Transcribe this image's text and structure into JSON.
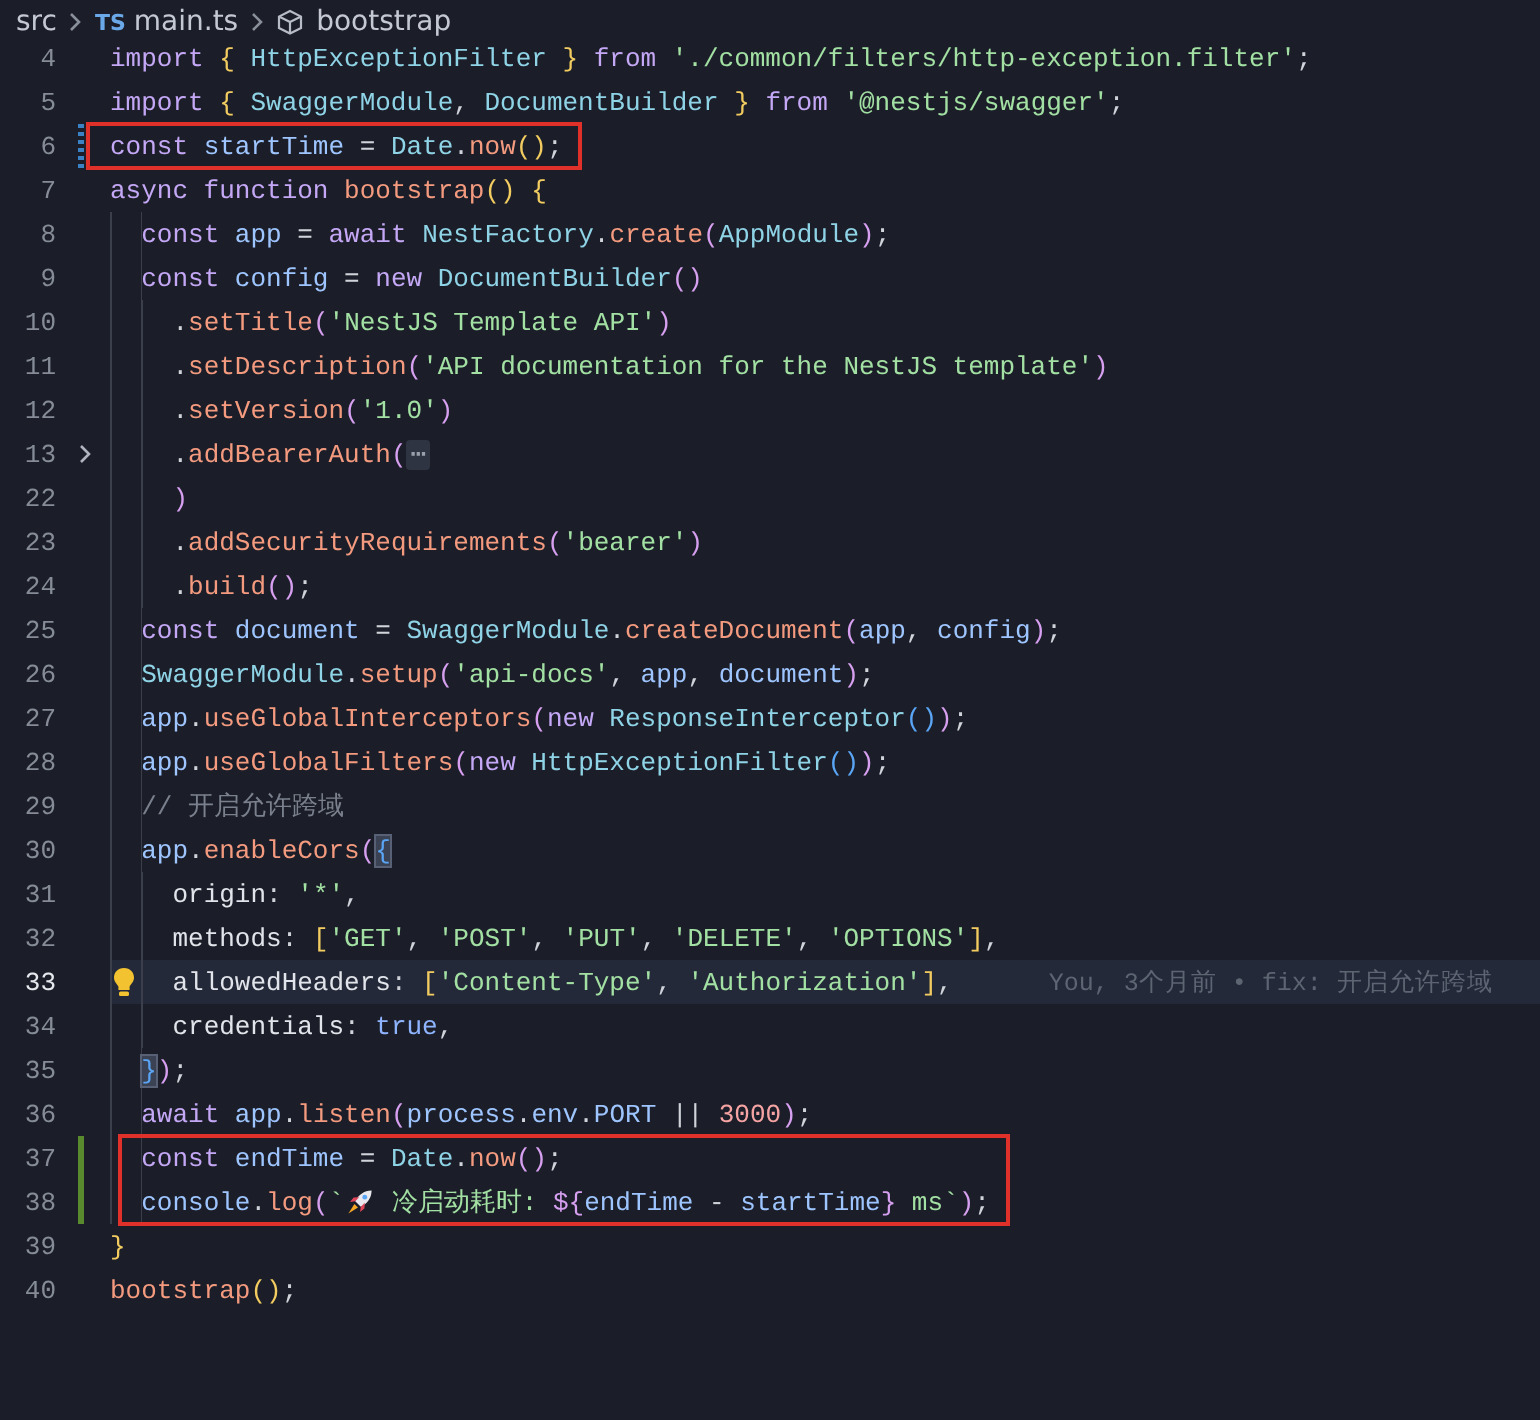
{
  "breadcrumb": {
    "folder": "src",
    "file_type": "TS",
    "file": "main.ts",
    "symbol": "bootstrap"
  },
  "lines": [
    {
      "n": "4",
      "modified": false,
      "added": false,
      "current": false,
      "folded": false,
      "boxed": false,
      "lightbulb": false,
      "tokens": [
        {
          "text": "import ",
          "kind": "keyword"
        },
        {
          "text": "{",
          "kind": "bracket1"
        },
        {
          "text": " HttpExceptionFilter ",
          "kind": "class"
        },
        {
          "text": "}",
          "kind": "bracket1"
        },
        {
          "text": " from ",
          "kind": "keyword"
        },
        {
          "text": "'./common/filters/http-exception.filter'",
          "kind": "string"
        },
        {
          "text": ";",
          "kind": "punctuation"
        }
      ]
    },
    {
      "n": "5",
      "modified": false,
      "added": false,
      "current": false,
      "folded": false,
      "boxed": false,
      "lightbulb": false,
      "tokens": [
        {
          "text": "import ",
          "kind": "keyword"
        },
        {
          "text": "{",
          "kind": "bracket1"
        },
        {
          "text": " SwaggerModule",
          "kind": "class"
        },
        {
          "text": ", ",
          "kind": "punctuation"
        },
        {
          "text": "DocumentBuilder ",
          "kind": "class"
        },
        {
          "text": "}",
          "kind": "bracket1"
        },
        {
          "text": " from ",
          "kind": "keyword"
        },
        {
          "text": "'@nestjs/swagger'",
          "kind": "string"
        },
        {
          "text": ";",
          "kind": "punctuation"
        }
      ]
    },
    {
      "n": "6",
      "modified": true,
      "added": false,
      "current": false,
      "folded": false,
      "boxed": true,
      "lightbulb": false,
      "tokens": [
        {
          "text": "const",
          "kind": "keyword"
        },
        {
          "text": " startTime",
          "kind": "variable"
        },
        {
          "text": " = ",
          "kind": "punctuation"
        },
        {
          "text": "Date",
          "kind": "class"
        },
        {
          "text": ".",
          "kind": "punctuation"
        },
        {
          "text": "now",
          "kind": "function"
        },
        {
          "text": "()",
          "kind": "bracket1"
        },
        {
          "text": ";",
          "kind": "punctuation"
        }
      ]
    },
    {
      "n": "7",
      "modified": false,
      "added": false,
      "current": false,
      "folded": false,
      "boxed": false,
      "lightbulb": false,
      "tokens": [
        {
          "text": "async function",
          "kind": "keyword"
        },
        {
          "text": " bootstrap",
          "kind": "function"
        },
        {
          "text": "() {",
          "kind": "bracket1"
        }
      ]
    },
    {
      "n": "8",
      "modified": false,
      "added": false,
      "current": false,
      "folded": false,
      "boxed": false,
      "lightbulb": false,
      "tokens": [
        {
          "text": "  const",
          "kind": "keyword"
        },
        {
          "text": " app",
          "kind": "variable"
        },
        {
          "text": " = ",
          "kind": "punctuation"
        },
        {
          "text": "await",
          "kind": "keyword"
        },
        {
          "text": " NestFactory",
          "kind": "class"
        },
        {
          "text": ".",
          "kind": "punctuation"
        },
        {
          "text": "create",
          "kind": "function"
        },
        {
          "text": "(",
          "kind": "bracket2"
        },
        {
          "text": "AppModule",
          "kind": "class"
        },
        {
          "text": ")",
          "kind": "bracket2"
        },
        {
          "text": ";",
          "kind": "punctuation"
        }
      ]
    },
    {
      "n": "9",
      "modified": false,
      "added": false,
      "current": false,
      "folded": false,
      "boxed": false,
      "lightbulb": false,
      "tokens": [
        {
          "text": "  const",
          "kind": "keyword"
        },
        {
          "text": " config",
          "kind": "variable"
        },
        {
          "text": " = ",
          "kind": "punctuation"
        },
        {
          "text": "new",
          "kind": "keyword"
        },
        {
          "text": " DocumentBuilder",
          "kind": "class"
        },
        {
          "text": "()",
          "kind": "bracket2"
        }
      ]
    },
    {
      "n": "10",
      "modified": false,
      "added": false,
      "current": false,
      "folded": false,
      "boxed": false,
      "lightbulb": false,
      "tokens": [
        {
          "text": "    .",
          "kind": "punctuation"
        },
        {
          "text": "setTitle",
          "kind": "function"
        },
        {
          "text": "(",
          "kind": "bracket2"
        },
        {
          "text": "'NestJS Template API'",
          "kind": "string"
        },
        {
          "text": ")",
          "kind": "bracket2"
        }
      ]
    },
    {
      "n": "11",
      "modified": false,
      "added": false,
      "current": false,
      "folded": false,
      "boxed": false,
      "lightbulb": false,
      "tokens": [
        {
          "text": "    .",
          "kind": "punctuation"
        },
        {
          "text": "setDescription",
          "kind": "function"
        },
        {
          "text": "(",
          "kind": "bracket2"
        },
        {
          "text": "'API documentation for the NestJS template'",
          "kind": "string"
        },
        {
          "text": ")",
          "kind": "bracket2"
        }
      ]
    },
    {
      "n": "12",
      "modified": false,
      "added": false,
      "current": false,
      "folded": false,
      "boxed": false,
      "lightbulb": false,
      "tokens": [
        {
          "text": "    .",
          "kind": "punctuation"
        },
        {
          "text": "setVersion",
          "kind": "function"
        },
        {
          "text": "(",
          "kind": "bracket2"
        },
        {
          "text": "'1.0'",
          "kind": "string"
        },
        {
          "text": ")",
          "kind": "bracket2"
        }
      ]
    },
    {
      "n": "13",
      "modified": false,
      "added": false,
      "current": false,
      "folded": true,
      "boxed": false,
      "lightbulb": false,
      "tokens": [
        {
          "text": "    .",
          "kind": "punctuation"
        },
        {
          "text": "addBearerAuth",
          "kind": "function"
        },
        {
          "text": "(",
          "kind": "bracket2"
        },
        {
          "text": "⋯",
          "kind": "fold"
        }
      ]
    },
    {
      "n": "22",
      "modified": false,
      "added": false,
      "current": false,
      "folded": false,
      "boxed": false,
      "lightbulb": false,
      "tokens": [
        {
          "text": "    )",
          "kind": "bracket2"
        }
      ]
    },
    {
      "n": "23",
      "modified": false,
      "added": false,
      "current": false,
      "folded": false,
      "boxed": false,
      "lightbulb": false,
      "tokens": [
        {
          "text": "    .",
          "kind": "punctuation"
        },
        {
          "text": "addSecurityRequirements",
          "kind": "function"
        },
        {
          "text": "(",
          "kind": "bracket2"
        },
        {
          "text": "'bearer'",
          "kind": "string"
        },
        {
          "text": ")",
          "kind": "bracket2"
        }
      ]
    },
    {
      "n": "24",
      "modified": false,
      "added": false,
      "current": false,
      "folded": false,
      "boxed": false,
      "lightbulb": false,
      "tokens": [
        {
          "text": "    .",
          "kind": "punctuation"
        },
        {
          "text": "build",
          "kind": "function"
        },
        {
          "text": "()",
          "kind": "bracket2"
        },
        {
          "text": ";",
          "kind": "punctuation"
        }
      ]
    },
    {
      "n": "25",
      "modified": false,
      "added": false,
      "current": false,
      "folded": false,
      "boxed": false,
      "lightbulb": false,
      "tokens": [
        {
          "text": "  const",
          "kind": "keyword"
        },
        {
          "text": " document",
          "kind": "variable"
        },
        {
          "text": " = ",
          "kind": "punctuation"
        },
        {
          "text": "SwaggerModule",
          "kind": "class"
        },
        {
          "text": ".",
          "kind": "punctuation"
        },
        {
          "text": "createDocument",
          "kind": "function"
        },
        {
          "text": "(",
          "kind": "bracket2"
        },
        {
          "text": "app",
          "kind": "variable"
        },
        {
          "text": ", ",
          "kind": "punctuation"
        },
        {
          "text": "config",
          "kind": "variable"
        },
        {
          "text": ")",
          "kind": "bracket2"
        },
        {
          "text": ";",
          "kind": "punctuation"
        }
      ]
    },
    {
      "n": "26",
      "modified": false,
      "added": false,
      "current": false,
      "folded": false,
      "boxed": false,
      "lightbulb": false,
      "tokens": [
        {
          "text": "  SwaggerModule",
          "kind": "class"
        },
        {
          "text": ".",
          "kind": "punctuation"
        },
        {
          "text": "setup",
          "kind": "function"
        },
        {
          "text": "(",
          "kind": "bracket2"
        },
        {
          "text": "'api-docs'",
          "kind": "string"
        },
        {
          "text": ", ",
          "kind": "punctuation"
        },
        {
          "text": "app",
          "kind": "variable"
        },
        {
          "text": ", ",
          "kind": "punctuation"
        },
        {
          "text": "document",
          "kind": "variable"
        },
        {
          "text": ")",
          "kind": "bracket2"
        },
        {
          "text": ";",
          "kind": "punctuation"
        }
      ]
    },
    {
      "n": "27",
      "modified": false,
      "added": false,
      "current": false,
      "folded": false,
      "boxed": false,
      "lightbulb": false,
      "tokens": [
        {
          "text": "  app",
          "kind": "variable"
        },
        {
          "text": ".",
          "kind": "punctuation"
        },
        {
          "text": "useGlobalInterceptors",
          "kind": "function"
        },
        {
          "text": "(",
          "kind": "bracket2"
        },
        {
          "text": "new",
          "kind": "keyword"
        },
        {
          "text": " ResponseInterceptor",
          "kind": "class"
        },
        {
          "text": "()",
          "kind": "bracket3"
        },
        {
          "text": ")",
          "kind": "bracket2"
        },
        {
          "text": ";",
          "kind": "punctuation"
        }
      ]
    },
    {
      "n": "28",
      "modified": false,
      "added": false,
      "current": false,
      "folded": false,
      "boxed": false,
      "lightbulb": false,
      "tokens": [
        {
          "text": "  app",
          "kind": "variable"
        },
        {
          "text": ".",
          "kind": "punctuation"
        },
        {
          "text": "useGlobalFilters",
          "kind": "function"
        },
        {
          "text": "(",
          "kind": "bracket2"
        },
        {
          "text": "new",
          "kind": "keyword"
        },
        {
          "text": " HttpExceptionFilter",
          "kind": "class"
        },
        {
          "text": "()",
          "kind": "bracket3"
        },
        {
          "text": ")",
          "kind": "bracket2"
        },
        {
          "text": ";",
          "kind": "punctuation"
        }
      ]
    },
    {
      "n": "29",
      "modified": false,
      "added": false,
      "current": false,
      "folded": false,
      "boxed": false,
      "lightbulb": false,
      "tokens": [
        {
          "text": "  // 开启允许跨域",
          "kind": "comment"
        }
      ]
    },
    {
      "n": "30",
      "modified": false,
      "added": false,
      "current": false,
      "folded": false,
      "boxed": false,
      "lightbulb": false,
      "tokens": [
        {
          "text": "  app",
          "kind": "variable"
        },
        {
          "text": ".",
          "kind": "punctuation"
        },
        {
          "text": "enableCors",
          "kind": "function"
        },
        {
          "text": "(",
          "kind": "bracket2"
        },
        {
          "text": "{",
          "kind": "matched-bracket"
        }
      ]
    },
    {
      "n": "31",
      "modified": false,
      "added": false,
      "current": false,
      "folded": false,
      "boxed": false,
      "lightbulb": false,
      "tokens": [
        {
          "text": "    origin",
          "kind": "property"
        },
        {
          "text": ": ",
          "kind": "punctuation"
        },
        {
          "text": "'*'",
          "kind": "string"
        },
        {
          "text": ",",
          "kind": "punctuation"
        }
      ]
    },
    {
      "n": "32",
      "modified": false,
      "added": false,
      "current": false,
      "folded": false,
      "boxed": false,
      "lightbulb": false,
      "tokens": [
        {
          "text": "    methods",
          "kind": "property"
        },
        {
          "text": ": ",
          "kind": "punctuation"
        },
        {
          "text": "[",
          "kind": "bracket1"
        },
        {
          "text": "'GET'",
          "kind": "string"
        },
        {
          "text": ", ",
          "kind": "punctuation"
        },
        {
          "text": "'POST'",
          "kind": "string"
        },
        {
          "text": ", ",
          "kind": "punctuation"
        },
        {
          "text": "'PUT'",
          "kind": "string"
        },
        {
          "text": ", ",
          "kind": "punctuation"
        },
        {
          "text": "'DELETE'",
          "kind": "string"
        },
        {
          "text": ", ",
          "kind": "punctuation"
        },
        {
          "text": "'OPTIONS'",
          "kind": "string"
        },
        {
          "text": "]",
          "kind": "bracket1"
        },
        {
          "text": ",",
          "kind": "punctuation"
        }
      ]
    },
    {
      "n": "33",
      "modified": false,
      "added": false,
      "current": true,
      "folded": false,
      "boxed": false,
      "lightbulb": true,
      "blame": "You, 3个月前 • fix: 开启允许跨域",
      "tokens": [
        {
          "text": "    allowedHeaders",
          "kind": "property"
        },
        {
          "text": ": ",
          "kind": "punctuation"
        },
        {
          "text": "[",
          "kind": "bracket1"
        },
        {
          "text": "'Content-Type'",
          "kind": "string"
        },
        {
          "text": ", ",
          "kind": "punctuation"
        },
        {
          "text": "'Authorization'",
          "kind": "string"
        },
        {
          "text": "]",
          "kind": "bracket1"
        },
        {
          "text": ",",
          "kind": "punctuation"
        }
      ]
    },
    {
      "n": "34",
      "modified": false,
      "added": false,
      "current": false,
      "folded": false,
      "boxed": false,
      "lightbulb": false,
      "tokens": [
        {
          "text": "    credentials",
          "kind": "property"
        },
        {
          "text": ": ",
          "kind": "punctuation"
        },
        {
          "text": "true",
          "kind": "boolean"
        },
        {
          "text": ",",
          "kind": "punctuation"
        }
      ]
    },
    {
      "n": "35",
      "modified": false,
      "added": false,
      "current": false,
      "folded": false,
      "boxed": false,
      "lightbulb": false,
      "tokens": [
        {
          "text": "  }",
          "kind": "matched-bracket"
        },
        {
          "text": ")",
          "kind": "bracket2"
        },
        {
          "text": ";",
          "kind": "punctuation"
        }
      ]
    },
    {
      "n": "36",
      "modified": false,
      "added": false,
      "current": false,
      "folded": false,
      "boxed": false,
      "lightbulb": false,
      "tokens": [
        {
          "text": "  await",
          "kind": "keyword"
        },
        {
          "text": " app",
          "kind": "variable"
        },
        {
          "text": ".",
          "kind": "punctuation"
        },
        {
          "text": "listen",
          "kind": "function"
        },
        {
          "text": "(",
          "kind": "bracket2"
        },
        {
          "text": "process",
          "kind": "variable"
        },
        {
          "text": ".",
          "kind": "punctuation"
        },
        {
          "text": "env",
          "kind": "variable"
        },
        {
          "text": ".",
          "kind": "punctuation"
        },
        {
          "text": "PORT",
          "kind": "variable"
        },
        {
          "text": " || ",
          "kind": "punctuation"
        },
        {
          "text": "3000",
          "kind": "number"
        },
        {
          "text": ")",
          "kind": "bracket2"
        },
        {
          "text": ";",
          "kind": "punctuation"
        }
      ]
    },
    {
      "n": "37",
      "modified": false,
      "added": true,
      "current": false,
      "folded": false,
      "boxed": true,
      "lightbulb": false,
      "tokens": [
        {
          "text": "  const",
          "kind": "keyword"
        },
        {
          "text": " endTime",
          "kind": "variable"
        },
        {
          "text": " = ",
          "kind": "punctuation"
        },
        {
          "text": "Date",
          "kind": "class"
        },
        {
          "text": ".",
          "kind": "punctuation"
        },
        {
          "text": "now",
          "kind": "function"
        },
        {
          "text": "()",
          "kind": "bracket2"
        },
        {
          "text": ";",
          "kind": "punctuation"
        }
      ]
    },
    {
      "n": "38",
      "modified": false,
      "added": true,
      "current": false,
      "folded": false,
      "boxed": true,
      "lightbulb": false,
      "tokens": [
        {
          "text": "  console",
          "kind": "variable"
        },
        {
          "text": ".",
          "kind": "punctuation"
        },
        {
          "text": "log",
          "kind": "function"
        },
        {
          "text": "(",
          "kind": "bracket2"
        },
        {
          "text": "`",
          "kind": "string"
        },
        {
          "kind": "rocket"
        },
        {
          "text": " 冷启动耗时: ",
          "kind": "string"
        },
        {
          "text": "${",
          "kind": "template"
        },
        {
          "text": "endTime",
          "kind": "variable"
        },
        {
          "text": " - ",
          "kind": "punctuation"
        },
        {
          "text": "startTime",
          "kind": "variable"
        },
        {
          "text": "}",
          "kind": "template"
        },
        {
          "text": " ms`",
          "kind": "string"
        },
        {
          "text": ")",
          "kind": "bracket2"
        },
        {
          "text": ";",
          "kind": "punctuation"
        }
      ]
    },
    {
      "n": "39",
      "modified": false,
      "added": false,
      "current": false,
      "folded": false,
      "boxed": false,
      "lightbulb": false,
      "tokens": [
        {
          "text": "}",
          "kind": "bracket1"
        }
      ]
    },
    {
      "n": "40",
      "modified": false,
      "added": false,
      "current": false,
      "folded": false,
      "boxed": false,
      "lightbulb": false,
      "tokens": [
        {
          "text": "bootstrap",
          "kind": "function"
        },
        {
          "text": "()",
          "kind": "bracket1"
        },
        {
          "text": ";",
          "kind": "punctuation"
        }
      ]
    }
  ]
}
